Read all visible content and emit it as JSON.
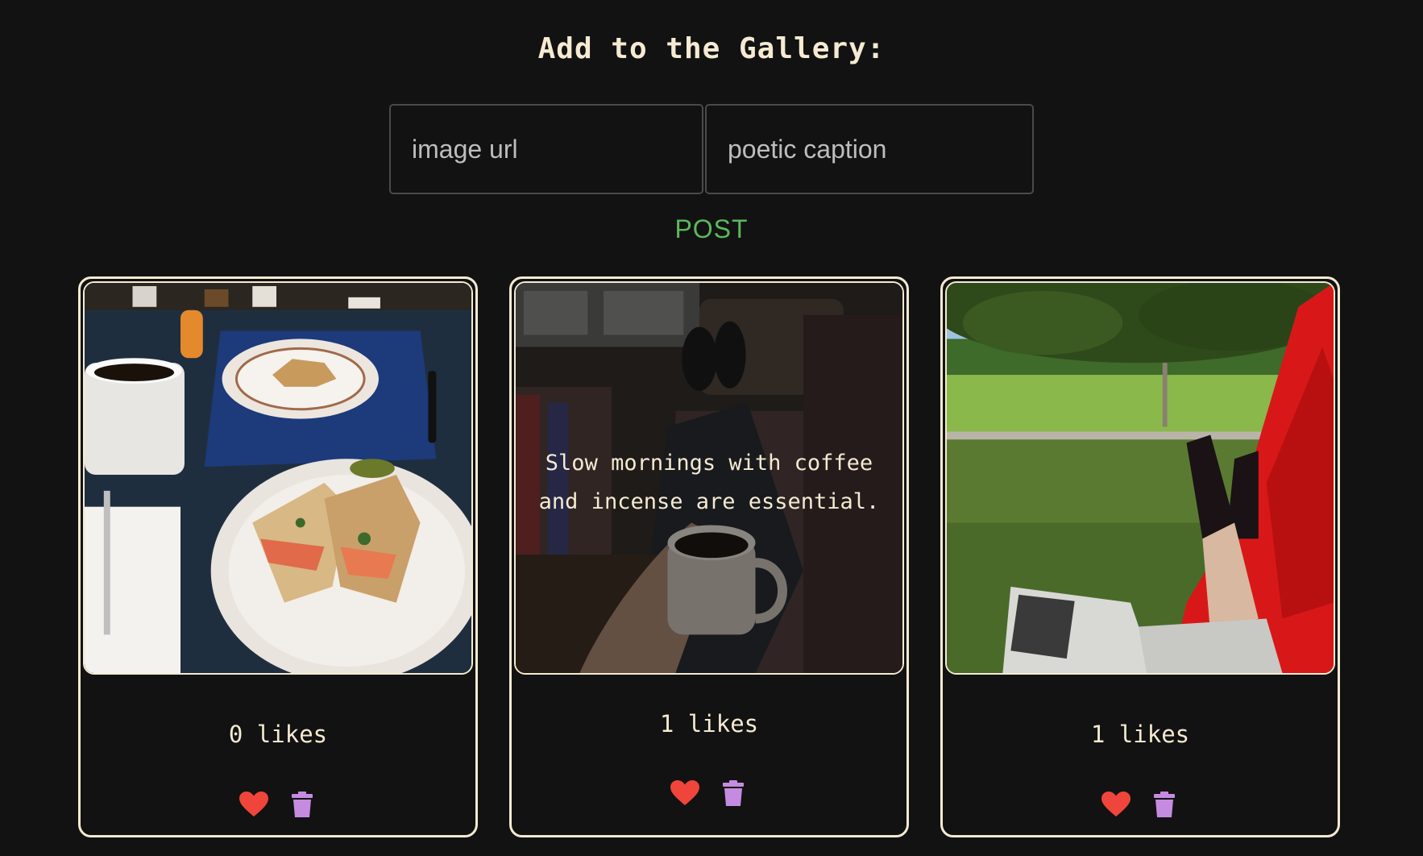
{
  "form": {
    "heading": "Add to the Gallery:",
    "url_placeholder": "image url",
    "caption_placeholder": "poetic caption",
    "post_label": "POST"
  },
  "posts": [
    {
      "likes_text": "0 likes",
      "caption": "",
      "image": "breakfast table with bagel sandwiches, coffee mug and pastry"
    },
    {
      "likes_text": "1 likes",
      "caption": "Slow mornings with coffee and incense are essential.",
      "image": "feet up on a couch holding a mug of coffee"
    },
    {
      "likes_text": "1 likes",
      "caption": "",
      "image": "reading a book in a red hammock under a tree in a park"
    }
  ],
  "icons": {
    "like": "heart-icon",
    "delete": "trash-icon"
  },
  "colors": {
    "background": "#121212",
    "text": "#f5ead2",
    "post": "#5cb85c",
    "heart": "#f0453a",
    "trash": "#c58be0"
  }
}
